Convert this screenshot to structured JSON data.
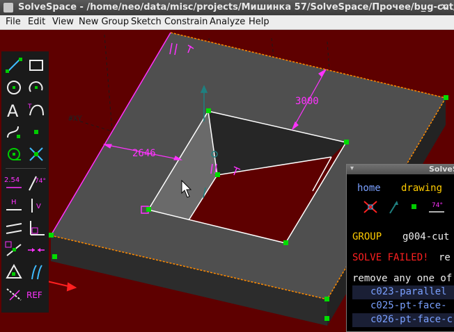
{
  "window": {
    "title": "SolveSpace - /home/neo/data/misc/projects/Мишинка 57/SolveSpace/Прочее/bug-cut/b"
  },
  "menu": [
    "File",
    "Edit",
    "View",
    "New Group",
    "Sketch",
    "Constrain",
    "Analyze",
    "Help"
  ],
  "toolbar": {
    "dimension_label": "2.54",
    "angle_label": "74°",
    "horizontal_label": "H",
    "vertical_label": "V",
    "reference_label": "REF"
  },
  "canvas": {
    "dimension_outer": "3000",
    "dimension_inner": "2646",
    "workplane_label": "#XY"
  },
  "text_window": {
    "title": "SolveS",
    "nav_home": "home",
    "nav_drawing": "drawing",
    "angle_label": "74°",
    "group_label": "GROUP",
    "group_name": "g004-cut",
    "solve_status": "SOLVE FAILED!",
    "solve_status_rest": "re",
    "remove_text": "remove any one of",
    "constraints": [
      "c023-parallel",
      "c025-pt-face-",
      "c026-pt-face-c"
    ]
  },
  "colors": {
    "background": "#5e0000",
    "surface": "#505050",
    "edge": "#ffffff",
    "constraint": "#ff33ff",
    "point": "#00cc00",
    "text_window_bg": "#000000",
    "error": "#ff2020"
  }
}
